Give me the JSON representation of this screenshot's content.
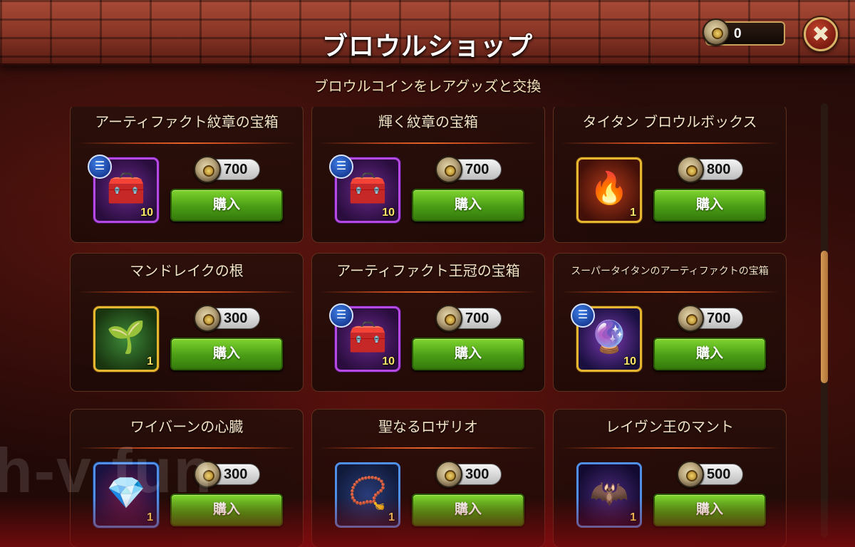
{
  "header": {
    "title": "ブロウルショップ",
    "coin_balance": "0",
    "close_glyph": "✖"
  },
  "subtitle": "ブロウルコインをレアグッズと交換",
  "buy_label": "購入",
  "watermark": "h-v fun",
  "items": [
    {
      "name": "アーティファクト紋章の宝箱",
      "price": "700",
      "qty": "10",
      "icon": "chest-icon",
      "has_info": true
    },
    {
      "name": "輝く紋章の宝箱",
      "price": "700",
      "qty": "10",
      "icon": "chest-icon",
      "has_info": true
    },
    {
      "name": "タイタン ブロウルボックス",
      "price": "800",
      "qty": "1",
      "icon": "forge-box-icon",
      "has_info": false
    },
    {
      "name": "マンドレイクの根",
      "price": "300",
      "qty": "1",
      "icon": "potion-jar-icon",
      "has_info": false
    },
    {
      "name": "アーティファクト王冠の宝箱",
      "price": "700",
      "qty": "10",
      "icon": "chest-icon",
      "has_info": true
    },
    {
      "name": "スーパータイタンのアーティファクトの宝箱",
      "price": "700",
      "qty": "10",
      "icon": "orb-chest-icon",
      "has_info": true
    },
    {
      "name": "ワイバーンの心臓",
      "price": "300",
      "qty": "1",
      "icon": "gem-heart-icon",
      "has_info": false
    },
    {
      "name": "聖なるロザリオ",
      "price": "300",
      "qty": "1",
      "icon": "rosary-icon",
      "has_info": false
    },
    {
      "name": "レイヴン王のマント",
      "price": "500",
      "qty": "1",
      "icon": "cloak-icon",
      "has_info": false
    }
  ],
  "colors": {
    "buy_green": "#4a9d15",
    "purple_frame": "#b44ae3",
    "gold_frame": "#e7b631",
    "blue_frame": "#4f8fe8",
    "accent_orange": "#e8672a"
  }
}
